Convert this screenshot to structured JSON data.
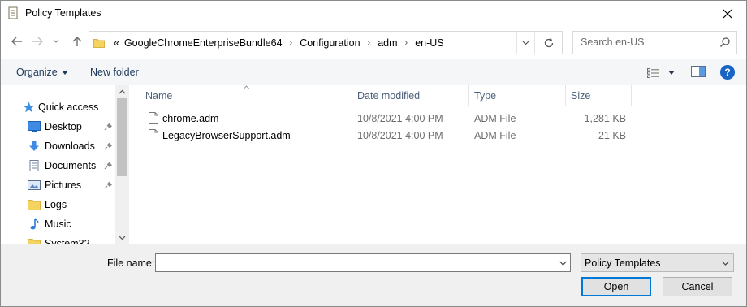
{
  "window": {
    "title": "Policy Templates",
    "close_glyph": "✕"
  },
  "address": {
    "overflow_glyph": "«",
    "breadcrumbs": [
      "GoogleChromeEnterpriseBundle64",
      "Configuration",
      "adm",
      "en-US"
    ],
    "separator": "›",
    "search_placeholder": "Search en-US"
  },
  "commands": {
    "organize": "Organize",
    "new_folder": "New folder",
    "help": "?"
  },
  "nav": {
    "items": [
      {
        "label": "Quick access",
        "icon": "star-icon",
        "pinned": false
      },
      {
        "label": "Desktop",
        "icon": "desktop-icon",
        "pinned": true
      },
      {
        "label": "Downloads",
        "icon": "download-icon",
        "pinned": true
      },
      {
        "label": "Documents",
        "icon": "document-icon",
        "pinned": true
      },
      {
        "label": "Pictures",
        "icon": "picture-icon",
        "pinned": true
      },
      {
        "label": "Logs",
        "icon": "folder-icon",
        "pinned": false
      },
      {
        "label": "Music",
        "icon": "music-icon",
        "pinned": false
      },
      {
        "label": "System32",
        "icon": "folder-icon",
        "pinned": false
      }
    ]
  },
  "files": {
    "columns": {
      "name": "Name",
      "date": "Date modified",
      "type": "Type",
      "size": "Size"
    },
    "rows": [
      {
        "name": "chrome.adm",
        "date": "10/8/2021 4:00 PM",
        "type": "ADM File",
        "size": "1,281 KB"
      },
      {
        "name": "LegacyBrowserSupport.adm",
        "date": "10/8/2021 4:00 PM",
        "type": "ADM File",
        "size": "21 KB"
      }
    ]
  },
  "footer": {
    "file_name_label": "File name:",
    "file_name_value": "",
    "file_type": "Policy Templates",
    "open_label": "Open",
    "cancel_label": "Cancel"
  },
  "colors": {
    "accent": "#0078d7",
    "folder": "#f4d35e",
    "help": "#1a64c5",
    "command_text": "#1e395b"
  }
}
